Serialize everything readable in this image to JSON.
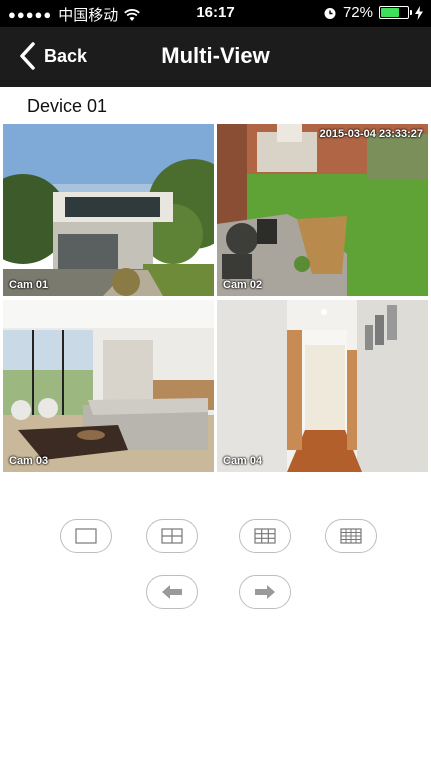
{
  "status_bar": {
    "signal": "●●●●●",
    "carrier": "中国移动",
    "time": "16:17",
    "battery_pct": "72%",
    "battery_level": 0.72
  },
  "nav": {
    "back_label": "Back",
    "title": "Multi-View"
  },
  "device_label": "Device 01",
  "cameras": [
    {
      "label": "Cam 01"
    },
    {
      "label": "Cam 02",
      "timestamp": "2015-03-04  23:33:27"
    },
    {
      "label": "Cam 03"
    },
    {
      "label": "Cam 04"
    }
  ],
  "controls": [
    {
      "icon": "single-view-icon"
    },
    {
      "icon": "quad-view-icon"
    },
    {
      "icon": "nine-view-icon"
    },
    {
      "icon": "sixteen-view-icon"
    },
    {
      "icon": "prev-arrow-icon"
    },
    {
      "icon": "next-arrow-icon"
    }
  ]
}
